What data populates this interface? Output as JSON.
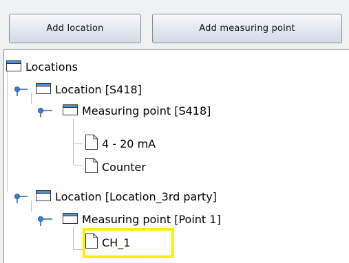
{
  "toolbar": {
    "add_location_label": "Add location",
    "add_measuring_point_label": "Add measuring point"
  },
  "tree": {
    "root": {
      "label": "Locations",
      "icon": "folder-icon"
    },
    "location_1": {
      "label": "Location [S418]",
      "icon": "folder-icon",
      "expanded": true
    },
    "measuring_point_1": {
      "label": "Measuring point [S418]",
      "icon": "folder-icon",
      "expanded": true
    },
    "channel_1": {
      "label": "4 - 20 mA",
      "icon": "document-icon"
    },
    "channel_2": {
      "label": "Counter",
      "icon": "document-icon"
    },
    "location_2": {
      "label": "Location [Location_3rd party]",
      "icon": "folder-icon",
      "expanded": true
    },
    "measuring_point_2": {
      "label": "Measuring point [Point 1]",
      "icon": "folder-icon",
      "expanded": true
    },
    "channel_3": {
      "label": "CH_1",
      "icon": "document-icon",
      "highlighted": true
    }
  },
  "colors": {
    "highlight": "#ffef00",
    "button_border": "#7a8a9a",
    "tree_background": "#ffffff",
    "window_background": "#eef0f2"
  }
}
